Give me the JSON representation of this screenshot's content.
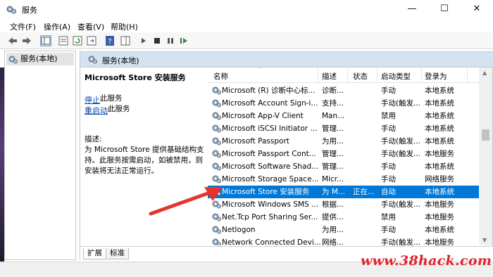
{
  "window": {
    "title": "服务",
    "minimize_icon": "minimize-icon",
    "maximize_icon": "maximize-icon",
    "close_icon": "close-icon"
  },
  "menu": {
    "items": [
      "文件(F)",
      "操作(A)",
      "查看(V)",
      "帮助(H)"
    ]
  },
  "tree": {
    "root_label": "服务(本地)"
  },
  "main": {
    "header_title": "服务(本地)",
    "selected_service_title": "Microsoft Store 安装服务",
    "stop_link": "停止",
    "stop_suffix": "此服务",
    "restart_link": "重启动",
    "restart_suffix": "此服务",
    "description_label": "描述:",
    "description_text": "为 Microsoft Store 提供基础结构支持。此服务按需启动，如被禁用，则安装将无法正常运行。"
  },
  "table": {
    "columns": [
      "名称",
      "描述",
      "状态",
      "启动类型",
      "登录为"
    ],
    "rows": [
      {
        "name": "Microsoft (R) 诊断中心标...",
        "desc": "诊断...",
        "status": "",
        "startup": "手动",
        "logon": "本地系统"
      },
      {
        "name": "Microsoft Account Sign-i...",
        "desc": "支持...",
        "status": "",
        "startup": "手动(触发...",
        "logon": "本地系统"
      },
      {
        "name": "Microsoft App-V Client",
        "desc": "Man...",
        "status": "",
        "startup": "禁用",
        "logon": "本地系统"
      },
      {
        "name": "Microsoft iSCSI Initiator ...",
        "desc": "管理...",
        "status": "",
        "startup": "手动",
        "logon": "本地系统"
      },
      {
        "name": "Microsoft Passport",
        "desc": "为用...",
        "status": "",
        "startup": "手动(触发...",
        "logon": "本地系统"
      },
      {
        "name": "Microsoft Passport Cont...",
        "desc": "管理...",
        "status": "",
        "startup": "手动(触发...",
        "logon": "本地服务"
      },
      {
        "name": "Microsoft Software Shad...",
        "desc": "管理...",
        "status": "",
        "startup": "手动",
        "logon": "本地系统"
      },
      {
        "name": "Microsoft Storage Space...",
        "desc": "Micr...",
        "status": "",
        "startup": "手动",
        "logon": "网络服务"
      },
      {
        "name": "Microsoft Store 安装服务",
        "desc": "为 M...",
        "status": "正在...",
        "startup": "自动",
        "logon": "本地系统",
        "selected": true
      },
      {
        "name": "Microsoft Windows SMS ...",
        "desc": "根据...",
        "status": "",
        "startup": "手动(触发...",
        "logon": "本地服务"
      },
      {
        "name": "Net.Tcp Port Sharing Ser...",
        "desc": "提供...",
        "status": "",
        "startup": "禁用",
        "logon": "本地服务"
      },
      {
        "name": "Netlogon",
        "desc": "为用...",
        "status": "",
        "startup": "手动",
        "logon": "本地系统"
      },
      {
        "name": "Network Connected Devi...",
        "desc": "网络...",
        "status": "",
        "startup": "手动(触发...",
        "logon": "本地服务"
      }
    ]
  },
  "tabs": [
    "扩展",
    "标准"
  ],
  "watermark": "www.38hack.com",
  "colors": {
    "selection": "#0078d7",
    "header_bg": "#d5e2ef",
    "link": "#0645ad",
    "watermark": "#e0242a",
    "annotation_arrow": "#e8322c"
  }
}
